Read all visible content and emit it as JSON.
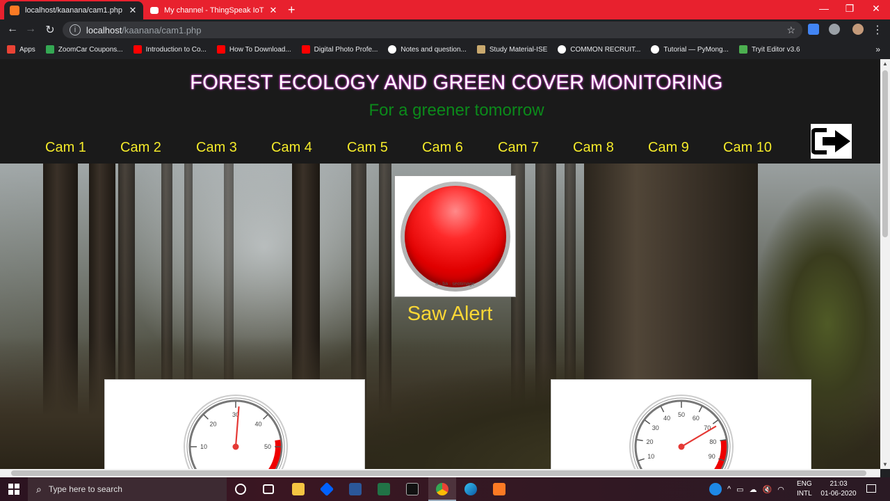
{
  "browser": {
    "tabs": [
      {
        "title": "localhost/kaanana/cam1.php",
        "active": true
      },
      {
        "title": "My channel - ThingSpeak IoT",
        "active": false
      }
    ],
    "url_host": "localhost",
    "url_path": "/kaanana/cam1.php",
    "bookmarks": [
      {
        "label": "Apps",
        "icon": "apps-grid-icon",
        "color": "#ea4335"
      },
      {
        "label": "ZoomCar Coupons...",
        "icon": "g-icon",
        "color": "#34a853"
      },
      {
        "label": "Introduction to Co...",
        "icon": "youtube-icon",
        "color": "#ff0000"
      },
      {
        "label": "How To Download...",
        "icon": "youtube-icon",
        "color": "#ff0000"
      },
      {
        "label": "Digital Photo Profe...",
        "icon": "youtube-icon",
        "color": "#ff0000"
      },
      {
        "label": "Notes and question...",
        "icon": "github-icon",
        "color": "#ffffff"
      },
      {
        "label": "Study Material-ISE",
        "icon": "study-icon",
        "color": "#c9a96e"
      },
      {
        "label": "COMMON RECRUIT...",
        "icon": "globe-icon",
        "color": "#ffffff"
      },
      {
        "label": "Tutorial — PyMong...",
        "icon": "globe-icon",
        "color": "#ffffff"
      },
      {
        "label": "Tryit Editor v3.6",
        "icon": "w3-icon",
        "color": "#4caf50"
      }
    ]
  },
  "page": {
    "title": "FOREST ECOLOGY AND GREEN COVER MONITORING",
    "subtitle": "For a greener tomorrow",
    "nav": [
      "Cam 1",
      "Cam 2",
      "Cam 3",
      "Cam 4",
      "Cam 5",
      "Cam 6",
      "Cam 7",
      "Cam 8",
      "Cam 9",
      "Cam 10"
    ],
    "alert_label": "Saw Alert",
    "alert_watermark": "a · ba · seotimage",
    "gauges": [
      {
        "ticks": [
          "10",
          "20",
          "30",
          "40",
          "50"
        ],
        "value": 31,
        "min": 0,
        "max": 60
      },
      {
        "ticks": [
          "10",
          "20",
          "30",
          "40",
          "50",
          "60",
          "70",
          "80",
          "90"
        ],
        "value": 72,
        "min": 0,
        "max": 100
      }
    ]
  },
  "taskbar": {
    "search_placeholder": "Type here to search",
    "lang_top": "ENG",
    "lang_bottom": "INTL",
    "time": "21:03",
    "date": "01-06-2020"
  },
  "colors": {
    "tabbar": "#e8212e",
    "nav_link": "#f4ea2a",
    "subtitle": "#0b8a1a",
    "alert_text": "#fdd835",
    "needle": "#e53935"
  }
}
